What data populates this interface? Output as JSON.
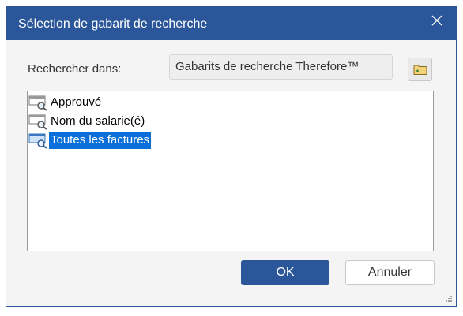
{
  "window": {
    "title": "Sélection de gabarit de recherche",
    "close_icon": "close-icon",
    "accent_color": "#2b579a"
  },
  "search": {
    "label": "Rechercher dans:",
    "location": "Gabarits de recherche Therefore™",
    "browse_icon": "folder-icon"
  },
  "templates": {
    "items": [
      {
        "label": "Approuvé",
        "icon": "search-template-icon",
        "selected": false
      },
      {
        "label": "Nom du salarie(é)",
        "icon": "search-template-icon",
        "selected": false
      },
      {
        "label": "Toutes les factures",
        "icon": "search-template-icon",
        "selected": true
      }
    ],
    "selection_color": "#0a6fd8"
  },
  "buttons": {
    "ok_label": "OK",
    "cancel_label": "Annuler"
  }
}
